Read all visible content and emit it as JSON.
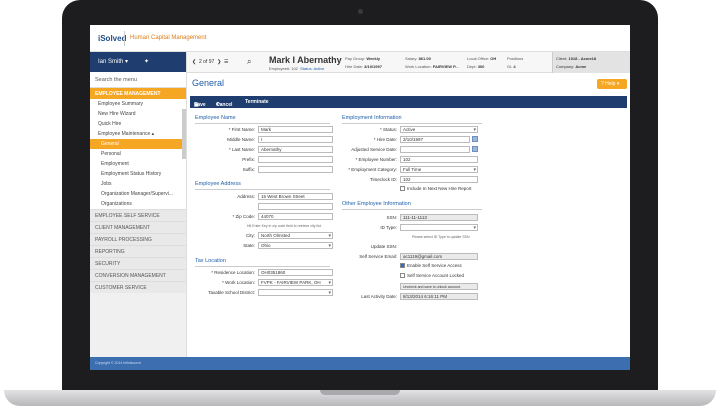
{
  "brand": {
    "logo": "iSolved",
    "app_name": "Human Capital Management"
  },
  "user": {
    "name": "Ian Smith ▾"
  },
  "nav": {
    "search_placeholder": "Search the menu",
    "section": "EMPLOYEE MANAGEMENT",
    "items": [
      "Employee Summary",
      "New Hire Wizard",
      "Quick Hire",
      "Employee Maintenance ▴"
    ],
    "sub_items": [
      "General",
      "Personal",
      "Employment",
      "Employment Status History",
      "Jobs",
      "Organization Manager/Supervi...",
      "Organizations"
    ],
    "main_items": [
      "EMPLOYEE SELF SERVICE",
      "CLIENT MANAGEMENT",
      "PAYROLL PROCESSING",
      "REPORTING",
      "SECURITY",
      "CONVERSION MANAGEMENT",
      "CUSTOMER SERVICE"
    ]
  },
  "header": {
    "pager": "2 of 97",
    "employee_name": "Mark I Abernathy",
    "employee_no": "Employee#: 102",
    "status": "Status: Active",
    "pay_group": "Weekly",
    "hire_date": "3/10/1997",
    "salary": "861.00",
    "work_location": "FAIRVIEW P...",
    "local_office": "OH",
    "dept": "300",
    "positions": "",
    "gl": "4",
    "client": "1018 - Acme18",
    "company": "Acme"
  },
  "labels": {
    "pay_group": "Pay Group:",
    "hire_date": "Hire Date:",
    "salary": "Salary:",
    "work_location": "Work Location:",
    "local_office": "Local Office:",
    "dept": "Dept:",
    "positions": "Positions",
    "gl": "GL",
    "client": "Client:",
    "company": "Company:"
  },
  "page": {
    "title": "General",
    "help": "? Help ▾"
  },
  "toolbar": {
    "save": "Save",
    "cancel": "Cancel",
    "terminate": "Terminate"
  },
  "employee_name_section": {
    "title": "Employee Name",
    "first_name_label": "* First Name:",
    "first_name": "Mark",
    "middle_name_label": "Middle Name:",
    "middle_name": "I",
    "last_name_label": "* Last Name:",
    "last_name": "Abernathy",
    "prefix_label": "Prefix:",
    "prefix": "",
    "suffix_label": "Suffix:",
    "suffix": ""
  },
  "address_section": {
    "title": "Employee Address",
    "address_label": "Address:",
    "address1": "15 West Brown Street",
    "address2": "",
    "zip_label": "* Zip Code:",
    "zip": "44070",
    "zip_hint": "Hit Enter Key in zip code field to retrieve city list.",
    "city_label": "City:",
    "city": "North Olmsted",
    "state_label": "State:",
    "state": "Ohio"
  },
  "tax_section": {
    "title": "Tax Location",
    "residence_label": "* Residence Location:",
    "residence": "OH0351860",
    "work_label": "* Work Location:",
    "work": "FVPK - FAIRVIEW PARK, OH",
    "school_label": "Taxable School District:",
    "school": ""
  },
  "employment_section": {
    "title": "Employment Information",
    "status_label": "* Status:",
    "status": "Active",
    "hire_date_label": "* Hire Date:",
    "hire_date": "3/10/1997",
    "adjusted_label": "Adjusted Service Date:",
    "adjusted": "",
    "emp_number_label": "* Employee Number:",
    "emp_number": "102",
    "category_label": "* Employment Category:",
    "category": "Full Time",
    "timeclock_label": "Timeclock ID:",
    "timeclock": "102",
    "new_hire_report": "Include In Next New Hire Report"
  },
  "other_section": {
    "title": "Other Employee Information",
    "ssn_label": "SSN:",
    "ssn": "111-11-1113",
    "id_type_label": "ID Type:",
    "id_type": "",
    "id_hint": "Please select ID Type to update SSN",
    "update_ssn_label": "Update SSN:",
    "ss_email_label": "Self Service Email:",
    "ss_email": "ac1119@gmail.com",
    "enable_ss": "Enable Self Service Access",
    "account_locked": "Self Service Account Locked",
    "unlock_hint": "Uncheck and save to unlock account.",
    "last_activity_label": "Last Activity Date:",
    "last_activity": "8/13/2014 6:16:11 PM"
  },
  "footer": {
    "text": "Copyright © 2014 Infinisource"
  }
}
